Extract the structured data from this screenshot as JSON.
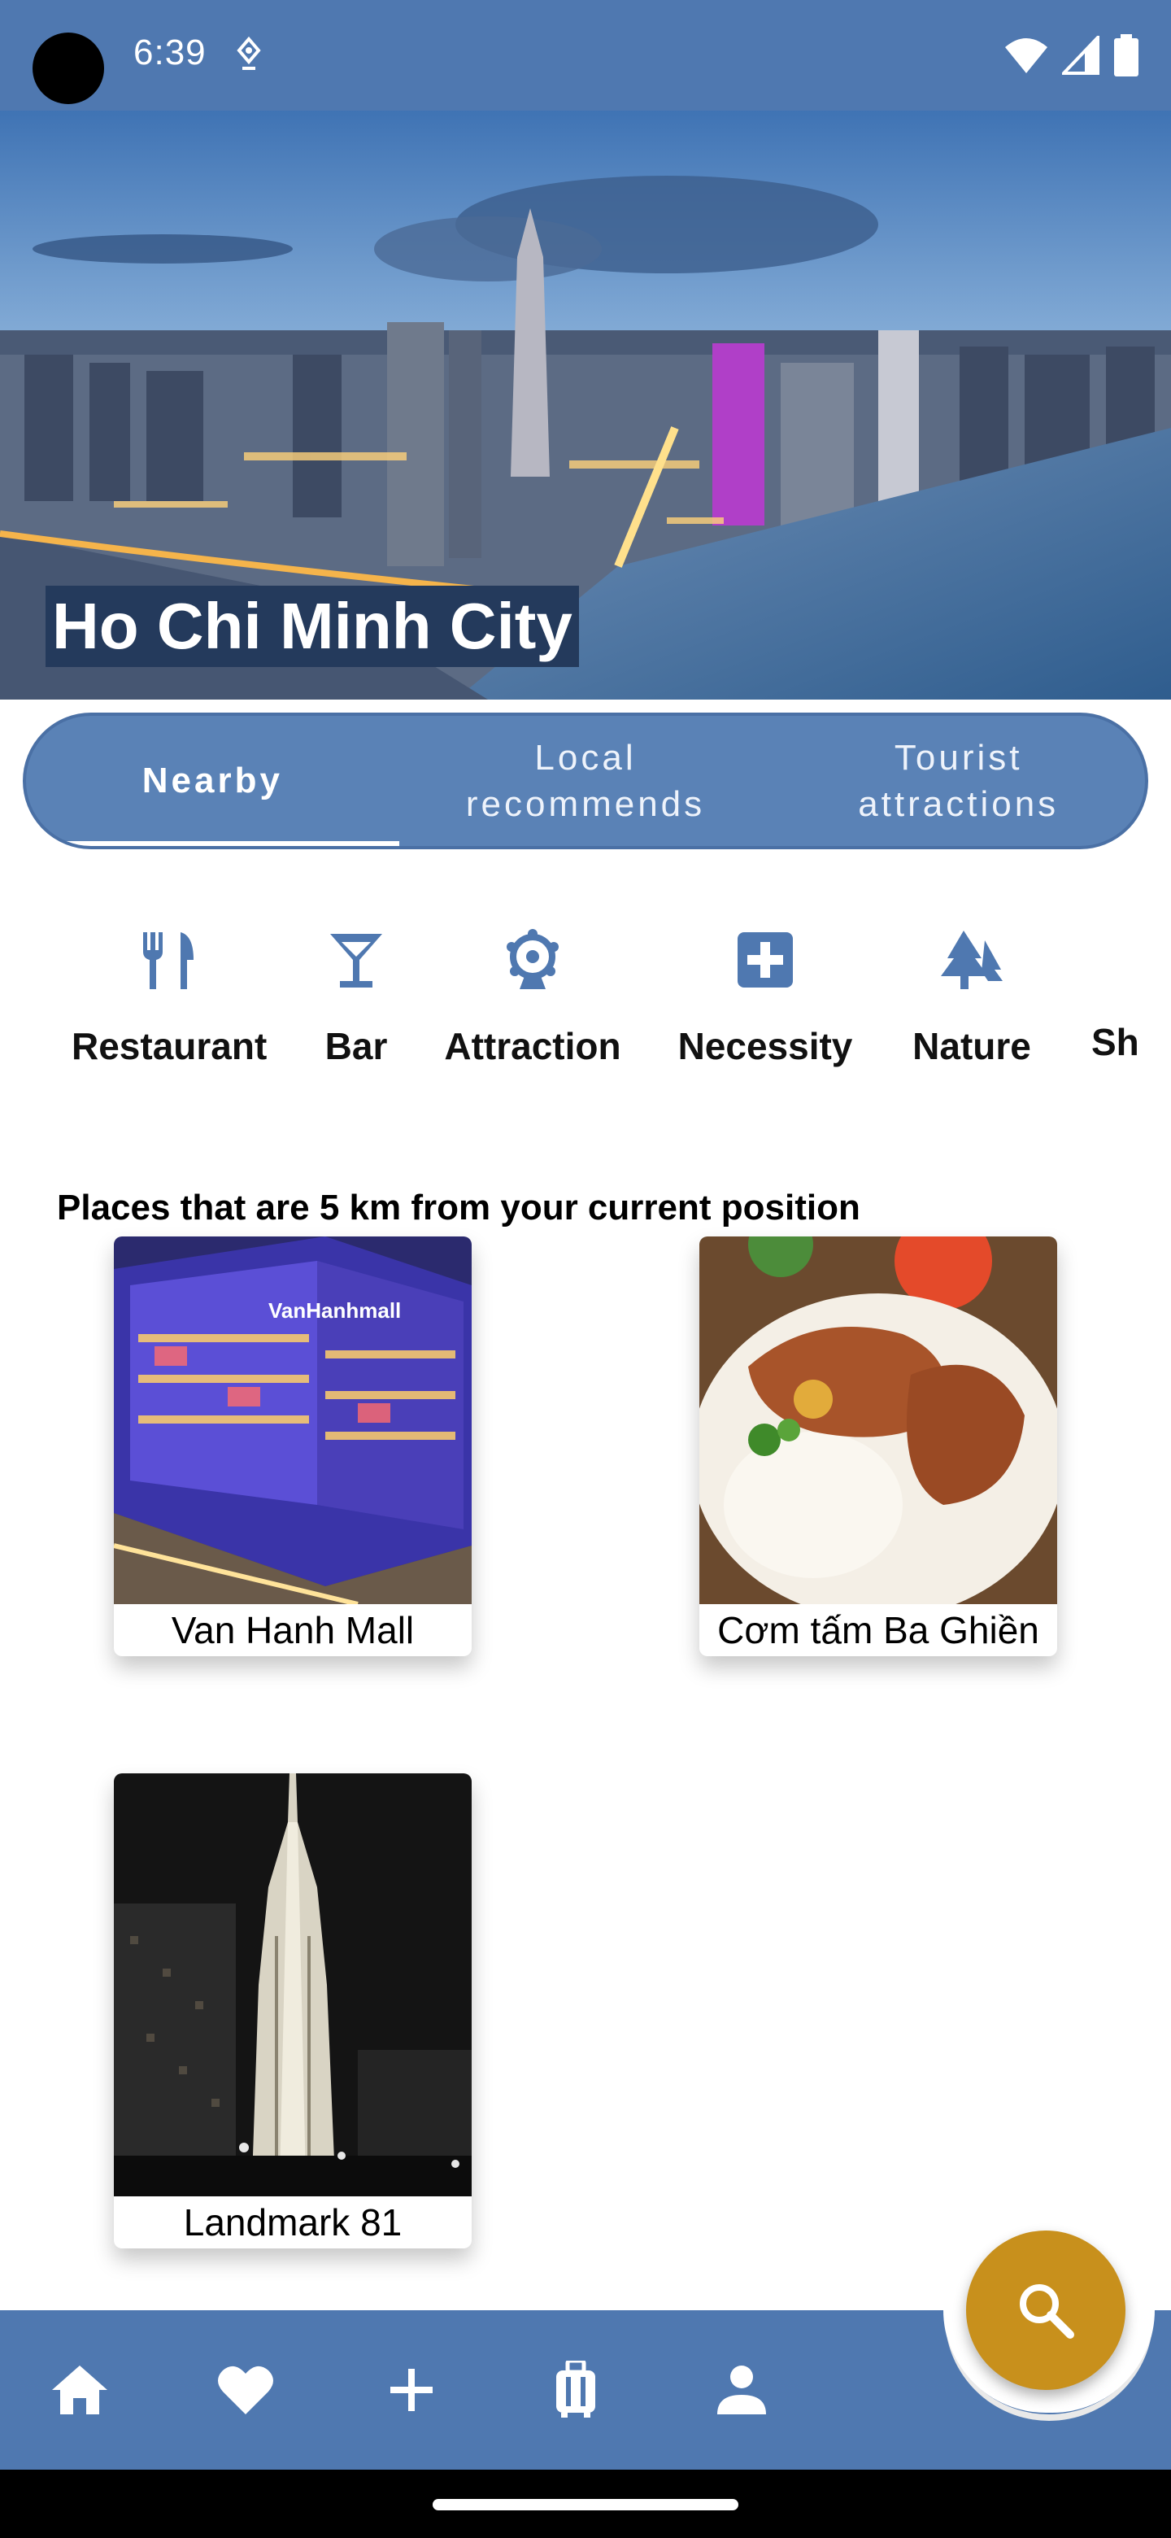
{
  "status_bar": {
    "time": "6:39",
    "icons": [
      "location-icon",
      "wifi-icon",
      "signal-icon",
      "battery-icon"
    ]
  },
  "hero": {
    "city": "Ho Chi Minh City"
  },
  "tabs": [
    {
      "label": "Nearby",
      "active": true
    },
    {
      "label": "Local\nrecommends",
      "active": false
    },
    {
      "label": "Tourist\nattractions",
      "active": false
    }
  ],
  "categories": [
    {
      "label": "Restaurant",
      "icon": "restaurant-icon"
    },
    {
      "label": "Bar",
      "icon": "bar-icon"
    },
    {
      "label": "Attraction",
      "icon": "attraction-icon"
    },
    {
      "label": "Necessity",
      "icon": "necessity-icon"
    },
    {
      "label": "Nature",
      "icon": "nature-icon"
    },
    {
      "label": "Sh",
      "icon": ""
    }
  ],
  "nearby": {
    "heading": "Places that are 5 km from your current position",
    "places": [
      {
        "name": "Van Hanh Mall",
        "image_sign": "VanHanhmall"
      },
      {
        "name": "Cơm tấm Ba Ghiền"
      },
      {
        "name": "Landmark 81"
      }
    ]
  },
  "fab": {
    "icon": "search-icon"
  },
  "bottom_nav": [
    {
      "icon": "home-icon"
    },
    {
      "icon": "heart-icon"
    },
    {
      "icon": "plus-icon"
    },
    {
      "icon": "luggage-icon"
    },
    {
      "icon": "person-icon"
    }
  ],
  "colors": {
    "primary": "#4f78b0",
    "tab_bg": "#5a82b6",
    "accent": "#c8901c"
  }
}
